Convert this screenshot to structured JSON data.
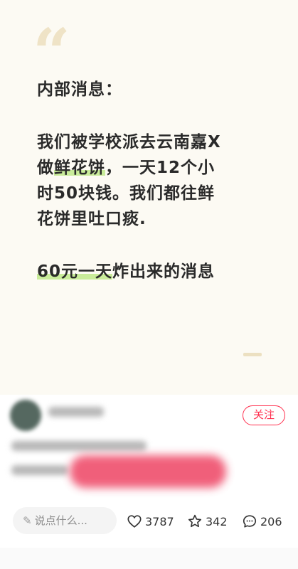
{
  "post": {
    "quote_glyph": "“",
    "lines": {
      "l1": "内部消息：",
      "l2": "我们被学校派去云南嘉X",
      "l3_pre": "做",
      "l3_hl": "鲜花饼",
      "l3_post": "，一天12个小",
      "l4": "时50块钱。我们都往鲜",
      "l5": "花饼里吐口痰.",
      "l6_hl": "60元一天",
      "l6_post": "炸出来的消息"
    }
  },
  "author": {
    "follow_label": "关注"
  },
  "actions": {
    "comment_placeholder": "说点什么...",
    "likes": "3787",
    "favorites": "342",
    "comments": "206"
  },
  "colors": {
    "accent": "#ff2e4d",
    "highlight": "#c9ec9a",
    "quote": "#efe3c6"
  }
}
